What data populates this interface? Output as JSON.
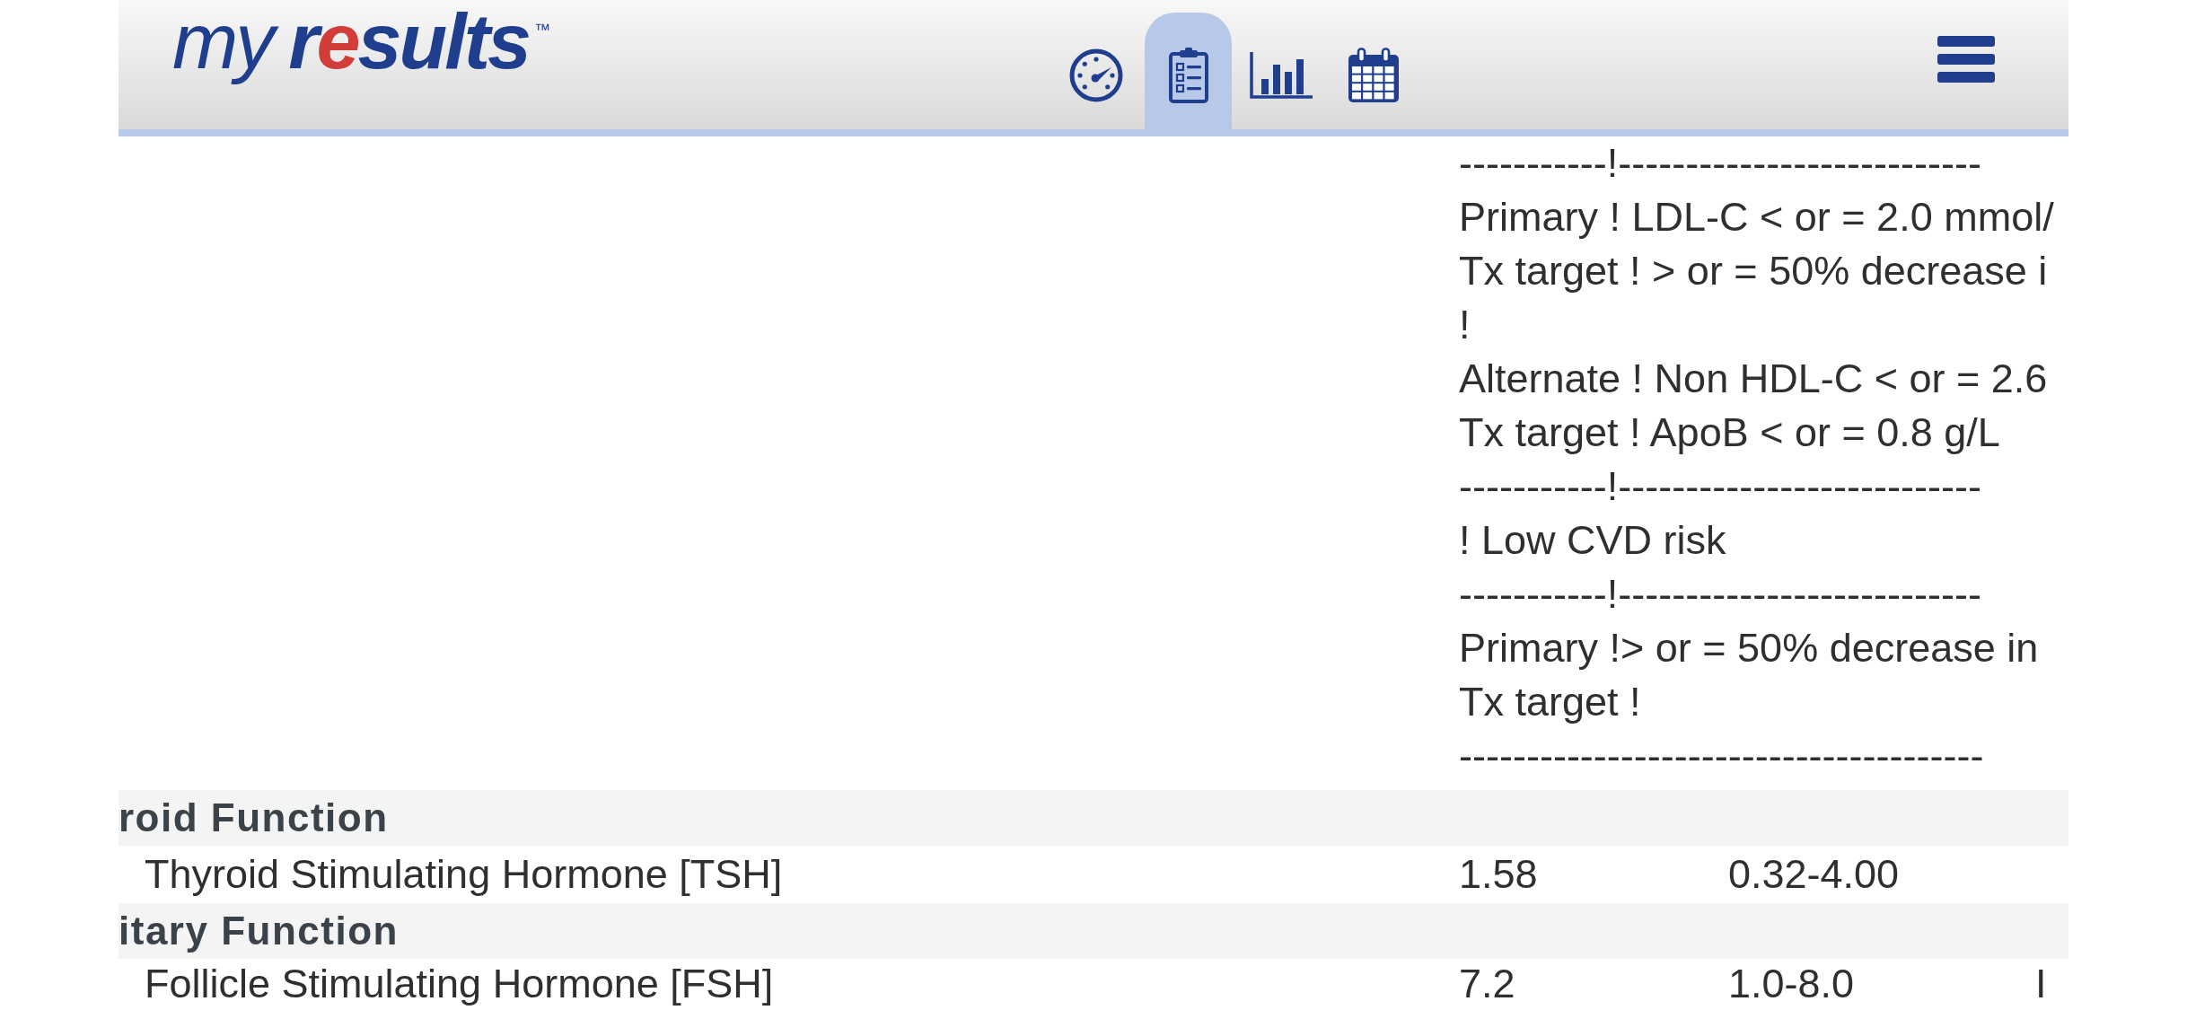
{
  "header": {
    "logo": {
      "prefix": "my",
      "name_parts": [
        {
          "text": "r",
          "color": "#1f3f8e"
        },
        {
          "text": "e",
          "color": "#d23c39"
        },
        {
          "text": "sults",
          "color": "#1f3f8e"
        }
      ],
      "trademark": "™"
    },
    "tabs": [
      {
        "kind": "gauge",
        "selected": false
      },
      {
        "kind": "clipboard",
        "selected": true
      },
      {
        "kind": "bars",
        "selected": false
      },
      {
        "kind": "calendar",
        "selected": false
      }
    ]
  },
  "note_lines": [
    "-----------!---------------------------",
    "Primary ! LDL-C < or = 2.0 mmol/",
    "Tx target ! > or = 50% decrease i",
    "!",
    "Alternate ! Non HDL-C < or = 2.6",
    "Tx target ! ApoB < or = 0.8 g/L",
    "-----------!---------------------------",
    "! Low CVD risk",
    "-----------!---------------------------",
    "Primary !> or = 50% decrease in",
    "Tx target !",
    "---------------------------------------"
  ],
  "rows": [
    {
      "kind": "section",
      "title": "roid Function"
    },
    {
      "kind": "test",
      "cells": [
        "Thyroid Stimulating Hormone [TSH]",
        "1.58",
        "0.32-4.00"
      ]
    },
    {
      "kind": "section",
      "title": "itary Function"
    },
    {
      "kind": "test",
      "cells": [
        "Follicle Stimulating Hormone [FSH]",
        "7.2",
        "1.0-8.0",
        "I"
      ]
    }
  ]
}
